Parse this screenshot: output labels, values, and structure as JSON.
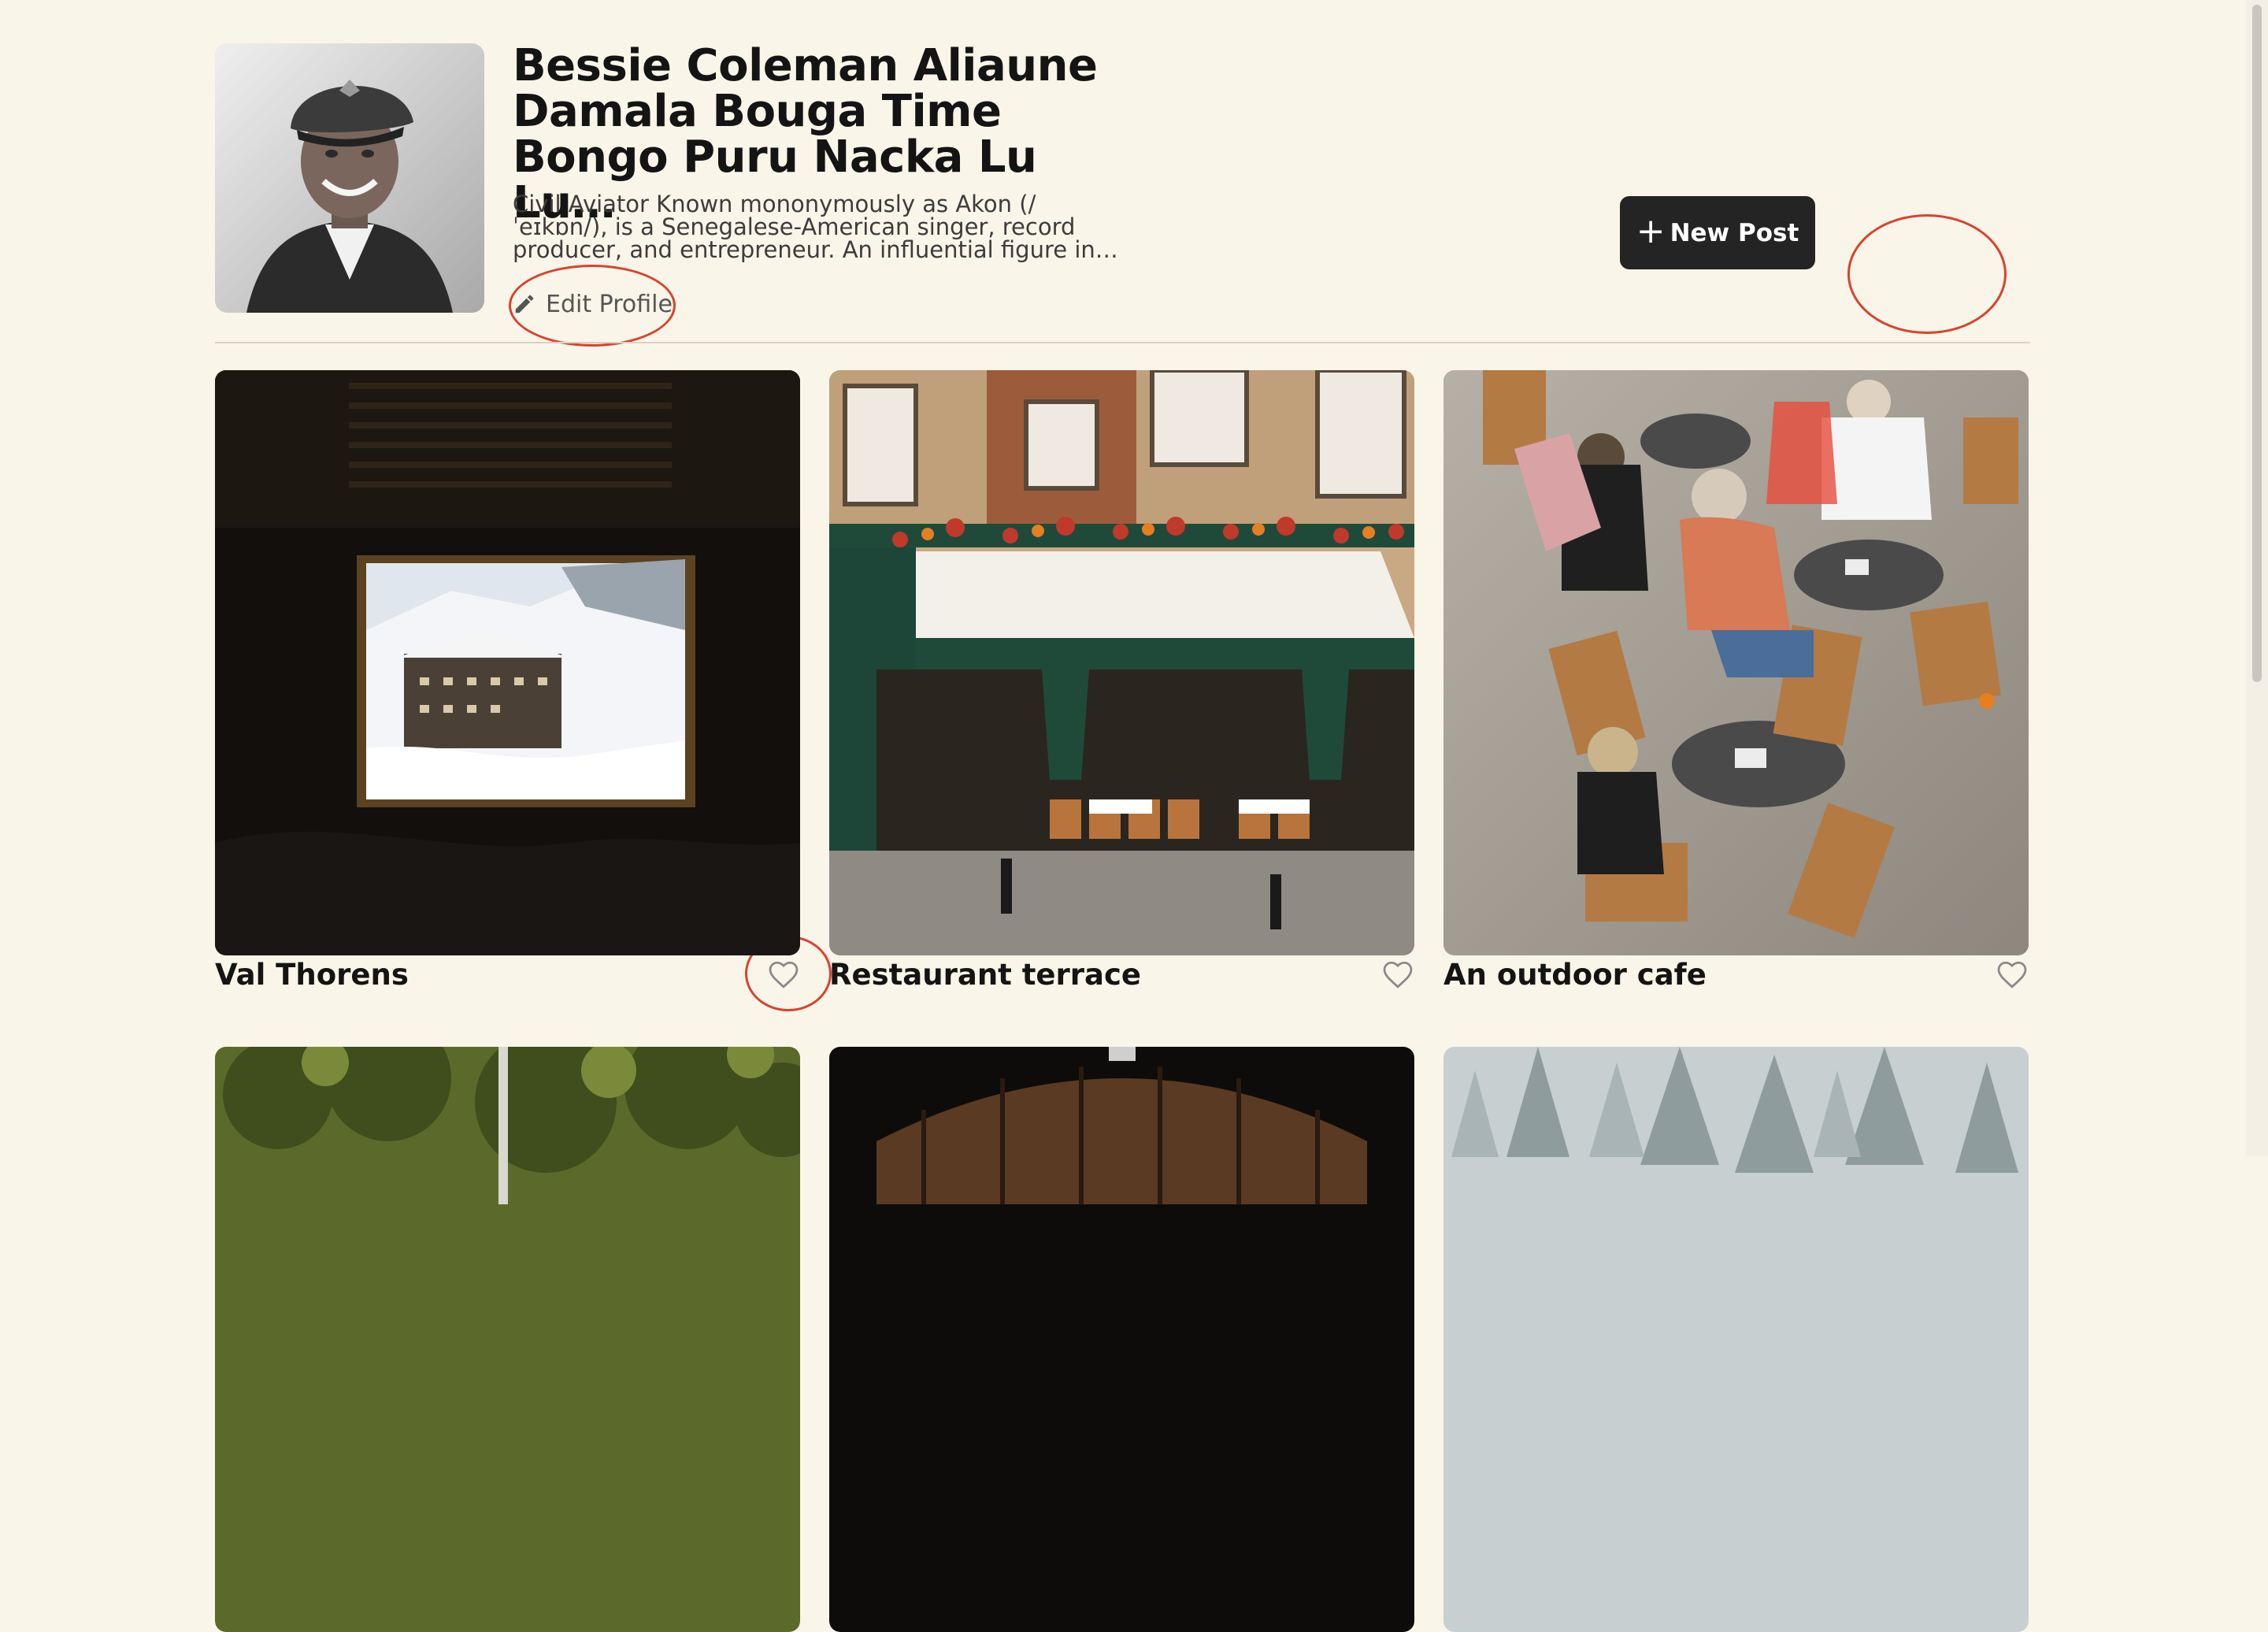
{
  "profile": {
    "name": "Bessie Coleman Aliaune Damala Bouga Time Bongo Puru Nacka Lu Lu…",
    "bio": "Civil Aviator Known mononymously as Akon (/ ˈeɪkɒn/), is a Senegalese-American singer, record producer, and entrepreneur. An influential figure in…",
    "edit_label": "Edit Profile",
    "avatar_icon": "person-portrait"
  },
  "actions": {
    "new_post_label": "New Post",
    "new_post_icon": "plus-icon"
  },
  "colors": {
    "background": "#FAF5E9",
    "button_dark": "#242424",
    "annotation": "#D9432E"
  },
  "posts": [
    {
      "title": "Val Thorens",
      "liked": false
    },
    {
      "title": "Restaurant terrace",
      "liked": false
    },
    {
      "title": "An outdoor cafe",
      "liked": false
    },
    {
      "title": "",
      "liked": false
    },
    {
      "title": "",
      "liked": false
    },
    {
      "title": "",
      "liked": false
    }
  ]
}
